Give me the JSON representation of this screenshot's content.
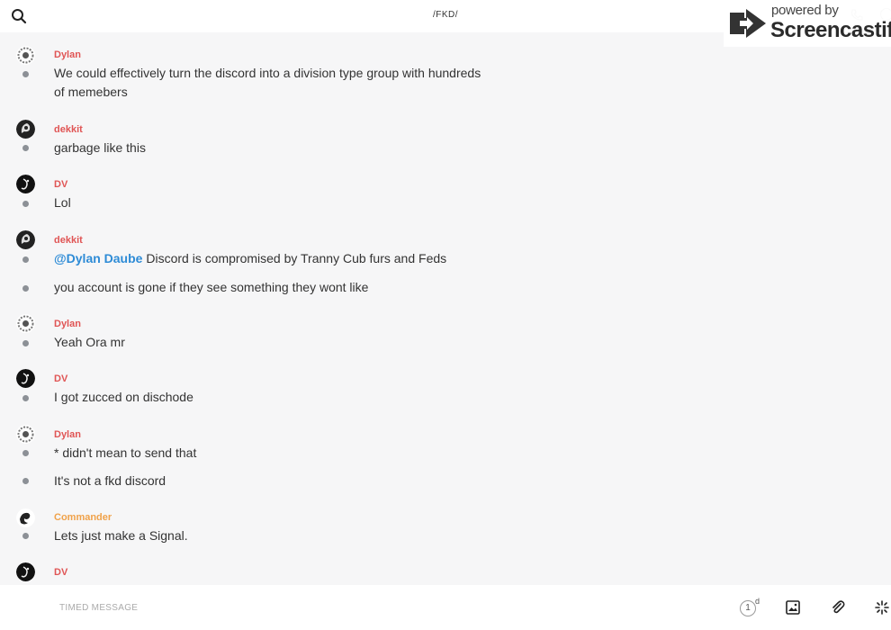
{
  "header": {
    "title": "/FKD/",
    "search_icon": "search-icon",
    "phone_icon": "phone-icon",
    "info_icon": "info-icon"
  },
  "watermark": {
    "powered": "powered by",
    "brand": "Screencastify"
  },
  "colors": {
    "sender_red": "#e05555",
    "sender_orange": "#f0a24a",
    "mention_blue": "#2d8bd6"
  },
  "messages": [
    {
      "sender": "Dylan",
      "lines": [
        "We could effectively turn the discord into a division type group with hundreds",
        "of memebers"
      ]
    },
    {
      "sender": "dekkit",
      "lines": [
        "garbage like this"
      ]
    },
    {
      "sender": "DV",
      "lines": [
        "Lol"
      ]
    },
    {
      "sender": "dekkit",
      "lines": [
        {
          "mention": "@Dylan Daube",
          "text": " Discord is compromised by Tranny Cub furs and Feds"
        },
        "you account is gone if they see something they wont like"
      ]
    },
    {
      "sender": "Dylan",
      "lines": [
        "Yeah Ora mr"
      ]
    },
    {
      "sender": "DV",
      "lines": [
        "I got zucced on dischode"
      ]
    },
    {
      "sender": "Dylan",
      "lines": [
        "* didn't mean to send that",
        "It's not a fkd discord"
      ]
    },
    {
      "sender": "Commander",
      "lines": [
        "Lets just make a Signal."
      ]
    },
    {
      "sender": "DV",
      "lines": []
    }
  ],
  "composer": {
    "placeholder": "TIMED MESSAGE",
    "timer_value": "1",
    "timer_unit": "d",
    "image_icon": "image-icon",
    "attach_icon": "paperclip-icon",
    "more_icon": "sparkle-icon"
  }
}
